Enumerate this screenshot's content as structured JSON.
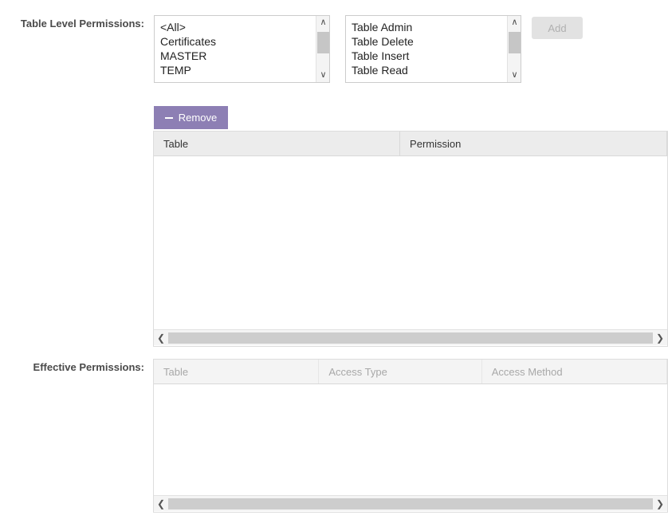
{
  "form": {
    "table_level_label": "Table Level Permissions:",
    "effective_label": "Effective Permissions:"
  },
  "tables_list": {
    "name": "table-list",
    "options": [
      "<All>",
      "Certificates",
      "MASTER",
      "TEMP"
    ],
    "scroll_up_icon": "chevron-up-icon",
    "scroll_down_icon": "chevron-down-icon"
  },
  "permissions_list": {
    "name": "permission-list",
    "options": [
      "Table Admin",
      "Table Delete",
      "Table Insert",
      "Table Read"
    ],
    "scroll_up_icon": "chevron-up-icon",
    "scroll_down_icon": "chevron-down-icon"
  },
  "buttons": {
    "add_label": "Add",
    "remove_label": "Remove",
    "remove_icon": "minus-icon",
    "remove_color": "#8d7fb4",
    "add_disabled_bg": "#e2e2e2",
    "add_disabled_text": "#b0b0b0"
  },
  "table_permissions_grid": {
    "columns": [
      "Table",
      "Permission"
    ],
    "rows": [],
    "scroll_left_icon": "chevron-left-icon",
    "scroll_right_icon": "chevron-right-icon"
  },
  "effective_grid": {
    "columns": [
      "Table",
      "Access Type",
      "Access Method"
    ],
    "rows": [],
    "scroll_left_icon": "chevron-left-icon",
    "scroll_right_icon": "chevron-right-icon"
  }
}
